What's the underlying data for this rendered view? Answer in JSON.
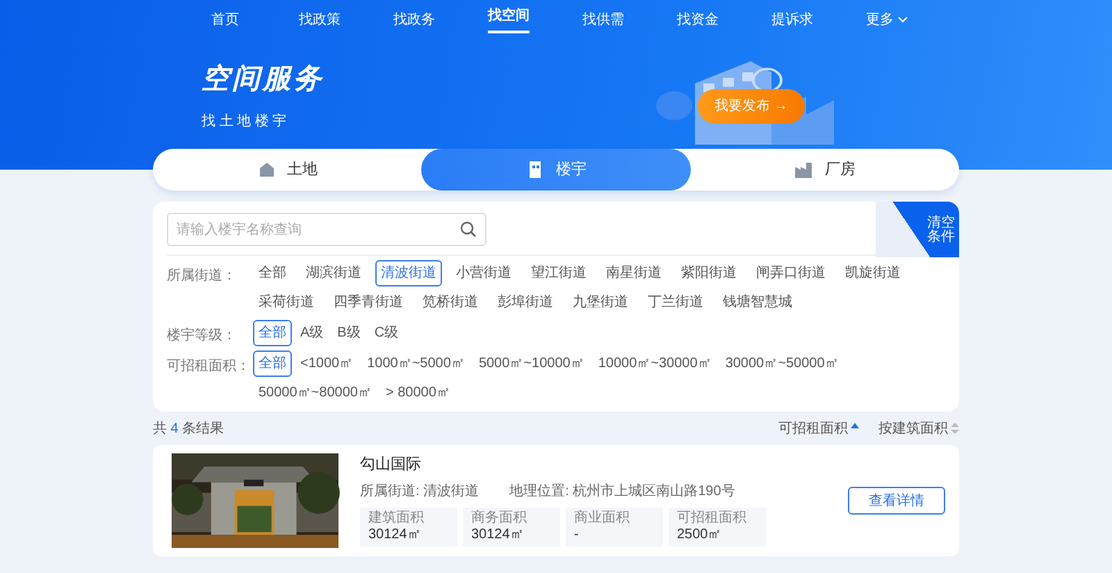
{
  "nav": [
    {
      "label": "首页",
      "selected": false
    },
    {
      "label": "找政策",
      "selected": false
    },
    {
      "label": "找政务",
      "selected": false
    },
    {
      "label": "找空间",
      "selected": true
    },
    {
      "label": "找供需",
      "selected": false
    },
    {
      "label": "找资金",
      "selected": false
    },
    {
      "label": "提诉求",
      "selected": false
    },
    {
      "label": "更多",
      "selected": false,
      "kind": "dropdown"
    }
  ],
  "hero": {
    "title": "空间服务",
    "subtitle": "找 土 地 楼 宇",
    "publish_button": "我要发布",
    "publish_arrow": "→"
  },
  "space_tabs": [
    {
      "label": "土地",
      "selected": false
    },
    {
      "label": "楼宇",
      "selected": true
    },
    {
      "label": "厂房",
      "selected": false
    }
  ],
  "search": {
    "placeholder": "请输入楼宇名称查询"
  },
  "clear_button": "清空条件",
  "filters": [
    {
      "label": "所属街道：",
      "options": [
        {
          "label": "全部",
          "selected": false
        },
        {
          "label": "湖滨街道",
          "selected": false
        },
        {
          "label": "清波街道",
          "selected": true
        },
        {
          "label": "小营街道",
          "selected": false
        },
        {
          "label": "望江街道",
          "selected": false
        },
        {
          "label": "南星街道",
          "selected": false
        },
        {
          "label": "紫阳街道",
          "selected": false
        },
        {
          "label": "闸弄口街道",
          "selected": false
        },
        {
          "label": "凯旋街道",
          "selected": false
        },
        {
          "label": "采荷街道",
          "selected": false
        },
        {
          "label": "四季青街道",
          "selected": false
        },
        {
          "label": "笕桥街道",
          "selected": false
        },
        {
          "label": "彭埠街道",
          "selected": false
        },
        {
          "label": "九堡街道",
          "selected": false
        },
        {
          "label": "丁兰街道",
          "selected": false
        },
        {
          "label": "钱塘智慧城",
          "selected": false
        }
      ]
    },
    {
      "label": "楼宇等级：",
      "options": [
        {
          "label": "全部",
          "selected": true
        },
        {
          "label": "A级",
          "selected": false
        },
        {
          "label": "B级",
          "selected": false
        },
        {
          "label": "C级",
          "selected": false
        }
      ]
    },
    {
      "label": "可招租面积：",
      "options": [
        {
          "label": "全部",
          "selected": true
        },
        {
          "label": "<1000㎡",
          "selected": false
        },
        {
          "label": "1000㎡~5000㎡",
          "selected": false
        },
        {
          "label": "5000㎡~10000㎡",
          "selected": false
        },
        {
          "label": "10000㎡~30000㎡",
          "selected": false
        },
        {
          "label": "30000㎡~50000㎡",
          "selected": false
        },
        {
          "label": "50000㎡~80000㎡",
          "selected": false
        },
        {
          "label": "> 80000㎡",
          "selected": false
        }
      ]
    }
  ],
  "results": {
    "prefix": "共",
    "count": "4",
    "suffix": "条结果",
    "sorts": [
      {
        "label": "可招租面积",
        "kind": "asc"
      },
      {
        "label": "按建筑面积",
        "kind": "none"
      }
    ]
  },
  "listings": [
    {
      "kind": "picture",
      "title": "勾山国际",
      "street": "所属街道: 清波街道",
      "location": "地理位置: 杭州市上城区南山路190号",
      "stats": [
        {
          "label": "建筑面积",
          "value": "30124㎡"
        },
        {
          "label": "商务面积",
          "value": "30124㎡"
        },
        {
          "label": "商业面积",
          "value": "-"
        },
        {
          "label": "可招租面积",
          "value": "2500㎡"
        }
      ],
      "button": "查看详情"
    }
  ]
}
